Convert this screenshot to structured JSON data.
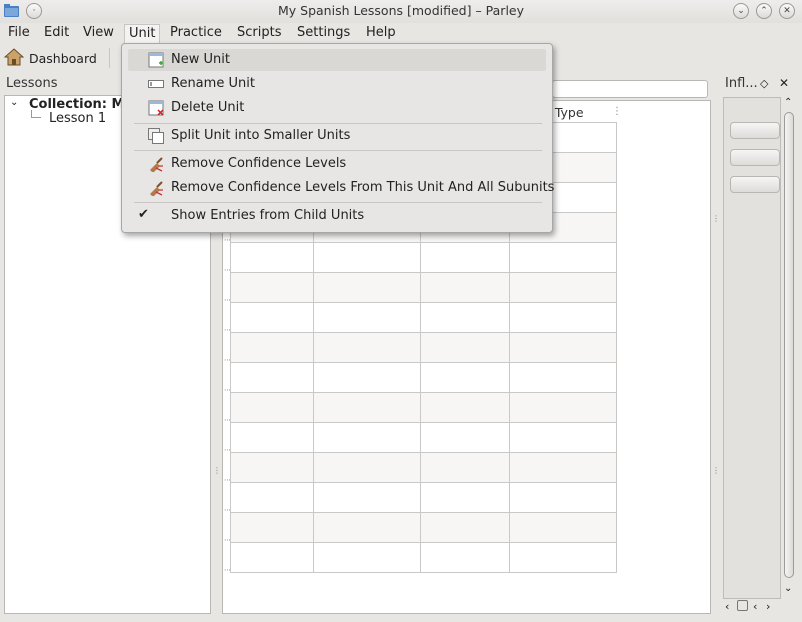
{
  "window": {
    "title": "My Spanish Lessons [modified] – Parley"
  },
  "menubar": {
    "items": [
      {
        "label": "File"
      },
      {
        "label": "Edit"
      },
      {
        "label": "View"
      },
      {
        "label": "Unit"
      },
      {
        "label": "Practice"
      },
      {
        "label": "Scripts"
      },
      {
        "label": "Settings"
      },
      {
        "label": "Help"
      }
    ]
  },
  "toolbar": {
    "dashboard_label": "Dashboard"
  },
  "lessons_panel": {
    "title": "Lessons",
    "collection_label": "Collection: My",
    "lesson_label": "Lesson 1"
  },
  "table": {
    "partial_header": "rd Type"
  },
  "inflection_panel": {
    "title": "Infl..."
  },
  "unit_menu": {
    "items": [
      {
        "label": "New Unit",
        "icon": "new-unit-icon",
        "highlighted": true
      },
      {
        "label": "Rename Unit",
        "icon": "rename-icon"
      },
      {
        "label": "Delete Unit",
        "icon": "delete-unit-icon"
      },
      {
        "label": "Split Unit into Smaller Units",
        "icon": "split-icon"
      },
      {
        "label": "Remove Confidence Levels",
        "icon": "broom-icon"
      },
      {
        "label": "Remove Confidence Levels From This Unit And All Subunits",
        "icon": "broom-icon"
      },
      {
        "label": "Show Entries from Child Units",
        "icon": "check-icon",
        "checked": true
      }
    ]
  }
}
